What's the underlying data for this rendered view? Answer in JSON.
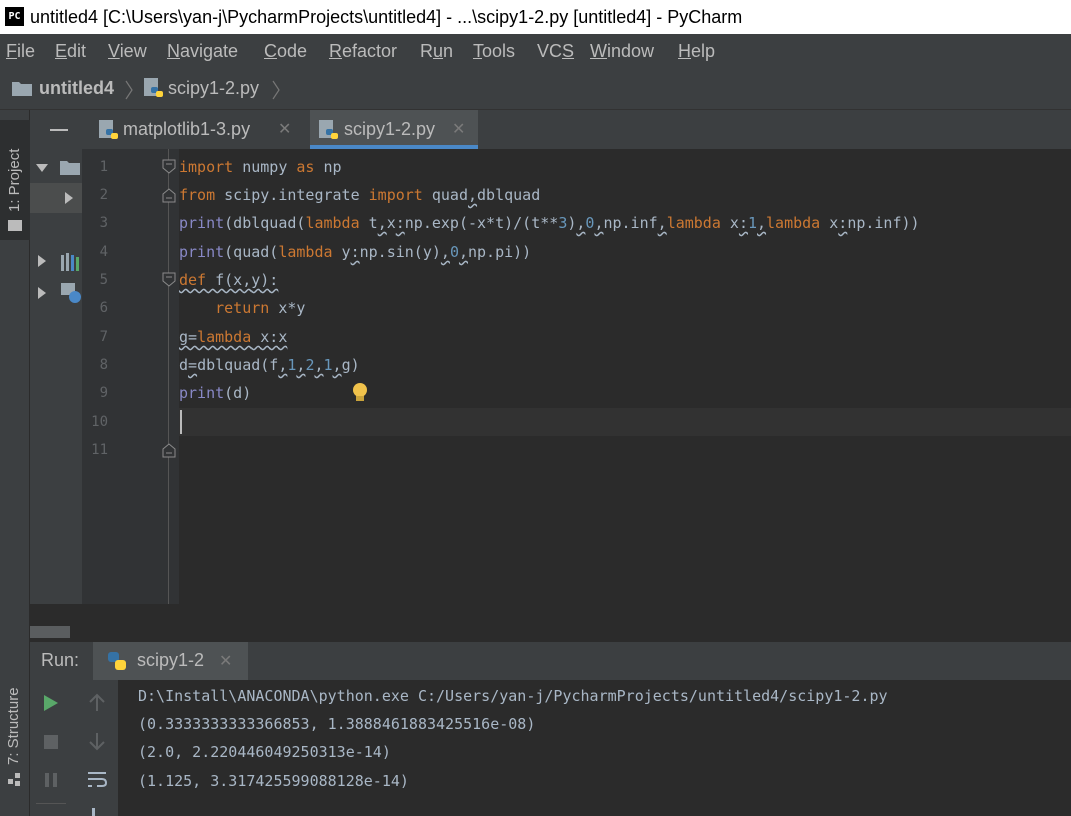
{
  "window": {
    "app_badge": "PC",
    "title": "untitled4 [C:\\Users\\yan-j\\PycharmProjects\\untitled4] - ...\\scipy1-2.py [untitled4] - PyCharm"
  },
  "menu": {
    "items": [
      {
        "label": "File",
        "mnemonic": "F",
        "rest": "ile"
      },
      {
        "label": "Edit",
        "mnemonic": "E",
        "rest": "dit"
      },
      {
        "label": "View",
        "mnemonic": "V",
        "rest": "iew"
      },
      {
        "label": "Navigate",
        "mnemonic": "N",
        "rest": "avigate"
      },
      {
        "label": "Code",
        "mnemonic": "C",
        "rest": "ode"
      },
      {
        "label": "Refactor",
        "mnemonic": "R",
        "rest": "efactor"
      },
      {
        "label": "Run",
        "mnemonic": "u",
        "pre": "R",
        "rest": "n"
      },
      {
        "label": "Tools",
        "mnemonic": "T",
        "rest": "ools"
      },
      {
        "label": "VCS",
        "mnemonic": "S",
        "pre": "VC",
        "rest": ""
      },
      {
        "label": "Window",
        "mnemonic": "W",
        "rest": "indow"
      },
      {
        "label": "Help",
        "mnemonic": "H",
        "rest": "elp"
      }
    ]
  },
  "breadcrumb": {
    "project": "untitled4",
    "file": "scipy1-2.py"
  },
  "side_tabs": {
    "project": "1: Project",
    "structure": "7: Structure"
  },
  "editor_tabs": [
    {
      "label": "matplotlib1-3.py",
      "active": false
    },
    {
      "label": "scipy1-2.py",
      "active": true
    }
  ],
  "code": {
    "line_numbers": [
      "1",
      "2",
      "3",
      "4",
      "5",
      "6",
      "7",
      "8",
      "9",
      "10",
      "11"
    ],
    "lines": [
      "import numpy as np",
      "from scipy.integrate import quad,dblquad",
      "print(dblquad(lambda t,x:np.exp(-x*t)/(t**3),0,np.inf,lambda x:1,lambda x:np.inf))",
      "print(quad(lambda y:np.sin(y),0,np.pi))",
      "def f(x,y):",
      "    return x*y",
      "g=lambda x:x",
      "d=dblquad(f,1,2,1,g)",
      "print(d)",
      "",
      ""
    ]
  },
  "run": {
    "label": "Run:",
    "config": "scipy1-2",
    "output": [
      "D:\\Install\\ANACONDA\\python.exe C:/Users/yan-j/PycharmProjects/untitled4/scipy1-2.py",
      "(0.3333333333366853, 1.3888461883425516e-08)",
      "(2.0, 2.220446049250313e-14)",
      "(1.125, 3.317425599088128e-14)"
    ]
  },
  "colors": {
    "keyword": "#cc7832",
    "builtin": "#8888c6",
    "number": "#6897bb",
    "text": "#a9b7c6",
    "run_green": "#59a869",
    "active_tab_underline": "#4a88c7"
  }
}
